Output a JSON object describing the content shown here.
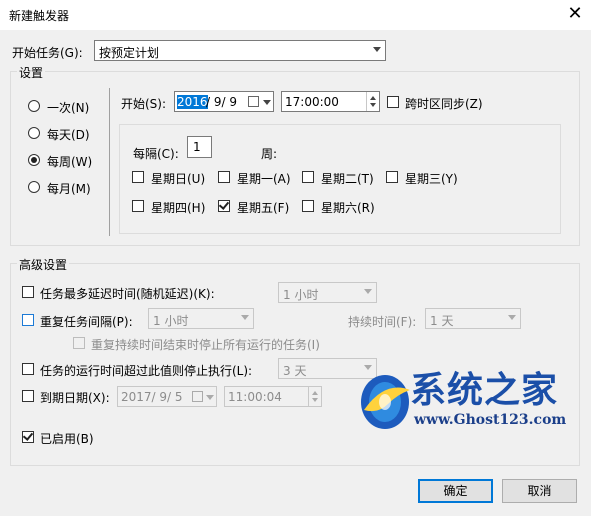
{
  "window": {
    "title": "新建触发器",
    "close_glyph": "✕"
  },
  "begin_task": {
    "label": "开始任务(G):",
    "value": "按预定计划"
  },
  "settings": {
    "group_label": "设置",
    "schedule_options": [
      {
        "label": "一次(N)",
        "checked": false
      },
      {
        "label": "每天(D)",
        "checked": false
      },
      {
        "label": "每周(W)",
        "checked": true
      },
      {
        "label": "每月(M)",
        "checked": false
      }
    ],
    "start_label": "开始(S):",
    "start_date_selected": "2016",
    "start_date_rest": "/  9/  9",
    "start_time": "17:00:00",
    "sync_timezone_label": "跨时区同步(Z)",
    "recur_label": "每隔(C):",
    "recur_value": "1",
    "recur_unit": "周:",
    "weekdays": [
      {
        "label": "星期日(U)",
        "checked": false
      },
      {
        "label": "星期一(A)",
        "checked": false
      },
      {
        "label": "星期二(T)",
        "checked": false
      },
      {
        "label": "星期三(Y)",
        "checked": false
      },
      {
        "label": "星期四(H)",
        "checked": false
      },
      {
        "label": "星期五(F)",
        "checked": true
      },
      {
        "label": "星期六(R)",
        "checked": false
      }
    ]
  },
  "advanced": {
    "group_label": "高级设置",
    "delay_label": "任务最多延迟时间(随机延迟)(K):",
    "delay_value": "1 小时",
    "repeat_label": "重复任务间隔(P):",
    "repeat_value": "1 小时",
    "duration_label": "持续时间(F):",
    "duration_value": "1 天",
    "stop_running_label": "重复持续时间结束时停止所有运行的任务(I)",
    "stop_longer_label": "任务的运行时间超过此值则停止执行(L):",
    "stop_longer_value": "3 天",
    "expire_label": "到期日期(X):",
    "expire_date": "2017/  9/  5",
    "expire_time": "11:00:04",
    "enabled_label": "已启用(B)",
    "enabled_checked": true
  },
  "watermark": {
    "brand": "系统之家",
    "url": "www.Ghost123.com"
  },
  "buttons": {
    "ok": "确定",
    "cancel": "取消"
  }
}
